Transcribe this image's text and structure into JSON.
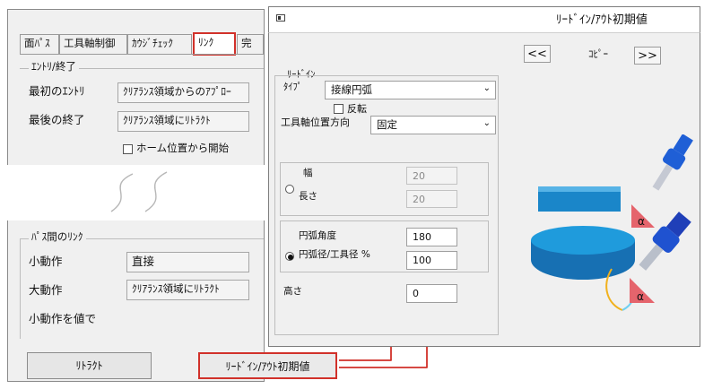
{
  "left_dialog": {
    "tabs": [
      {
        "label": "面ﾊﾟｽ"
      },
      {
        "label": "工具軸制御"
      },
      {
        "label": "ｶｳｼﾞﾁｪｯｸ"
      },
      {
        "label": "ﾘﾝｸ"
      },
      {
        "label": "完"
      }
    ],
    "entry_exit_group": {
      "title": "ｴﾝﾄﾘ/終了",
      "first_entry_label": "最初のｴﾝﾄﾘ",
      "first_entry_value": "ｸﾘｱﾗﾝｽ領域からのｱﾌﾟﾛｰ",
      "last_exit_label": "最後の終了",
      "last_exit_value": "ｸﾘｱﾗﾝｽ領域にﾘﾄﾗｸﾄ",
      "home_checkbox_label": "ホーム位置から開始"
    },
    "link_group": {
      "title": "ﾊﾟｽ間のﾘﾝｸ",
      "small_move_label": "小動作",
      "small_move_value": "直接",
      "large_move_label": "大動作",
      "large_move_value": "ｸﾘｱﾗﾝｽ領域にﾘﾄﾗｸﾄ",
      "small_move_by_value_label": "小動作を値で"
    },
    "retract_button": "ﾘﾄﾗｸﾄ",
    "leadin_defaults_button": "ﾘｰﾄﾞｲﾝ/ｱｳﾄ初期値"
  },
  "right_dialog": {
    "title": "ﾘｰﾄﾞｲﾝ/ｱｳﾄ初期値",
    "prev_button": "<<",
    "copy_label": "ｺﾋﾟｰ",
    "next_button": ">>",
    "leadin_section_label": "ﾘｰﾄﾞｲﾝ",
    "type_label": "ﾀｲﾌﾟ",
    "type_value": "接線円弧",
    "reverse_label": "反転",
    "tool_axis_dir_label": "工具軸位置方向",
    "tool_axis_dir_value": "固定",
    "width_label": "幅",
    "width_value": "20",
    "length_label": "長さ",
    "length_value": "20",
    "arc_angle_label": "円弧角度",
    "arc_angle_value": "180",
    "arc_ratio_label": "円弧径/工具径 %",
    "arc_ratio_value": "100",
    "height_label": "高さ",
    "height_value": "0"
  },
  "preview": {
    "alpha_symbol": "α"
  },
  "colors": {
    "highlight_red": "#d1312a",
    "tool_blue": "#1f5fd6",
    "part_blue": "#1a86c9",
    "alpha_red": "#e5646c"
  }
}
